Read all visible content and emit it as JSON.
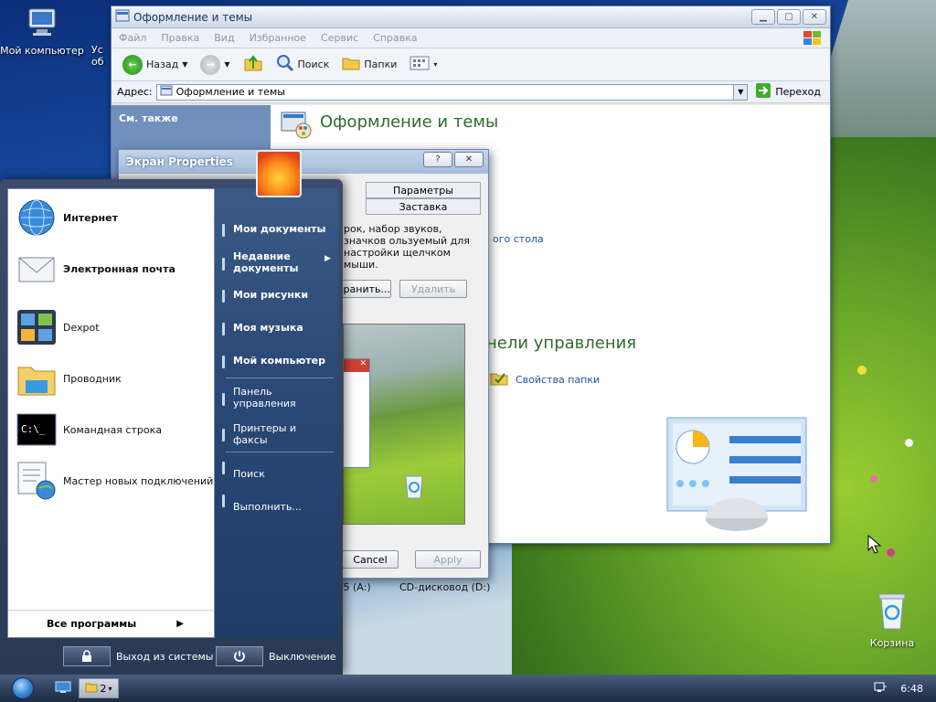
{
  "desktop": {
    "icons": [
      {
        "label": "Мой компьютер"
      },
      {
        "label": "Корзина"
      }
    ],
    "partial_label_a": "Ус",
    "partial_label_b": "об"
  },
  "window": {
    "title": "Оформление и темы",
    "menu": [
      "Файл",
      "Правка",
      "Вид",
      "Избранное",
      "Сервис",
      "Справка"
    ],
    "toolbar": {
      "back": "Назад",
      "search": "Поиск",
      "folders": "Папки"
    },
    "address": {
      "label": "Адрес:",
      "value": "Оформление и темы",
      "go": "Переход"
    },
    "left_pane": {
      "section": "См. также"
    },
    "content": {
      "title": "Оформление и темы",
      "link_desktop": "ого стола",
      "cp_header": "нели управления",
      "folder_options": "Свойства папки",
      "drive_floppy": ",5 (A:)",
      "drive_cd": "CD-дисковод (D:)"
    }
  },
  "dialog": {
    "title": "Экран Properties",
    "tabs": [
      "Параметры",
      "Заставка"
    ],
    "text": "рок, набор звуков, значков ользуемый для настройки щелчком мыши.",
    "save_button": "хранить...",
    "delete_button": "Удалить",
    "cancel_button": "Cancel",
    "apply_button": "Apply"
  },
  "start_menu": {
    "pinned": [
      {
        "label": "Интернет",
        "bold": true
      },
      {
        "label": "Электронная почта",
        "bold": true
      },
      {
        "label": "Dexpot",
        "bold": false
      },
      {
        "label": "Проводник",
        "bold": false
      },
      {
        "label": "Командная строка",
        "bold": false
      },
      {
        "label": "Мастер новых подключений",
        "bold": false
      }
    ],
    "all_programs": "Все программы",
    "right": {
      "my_documents": "Мои документы",
      "recent_docs": "Недавние документы",
      "my_pictures": "Мои рисунки",
      "my_music": "Моя музыка",
      "my_computer": "Мой компьютер",
      "control_panel": "Панель управления",
      "printers": "Принтеры и факсы",
      "search": "Поиск",
      "run": "Выполнить..."
    },
    "logoff": "Выход из системы",
    "shutdown": "Выключение"
  },
  "taskbar": {
    "group_count": "2",
    "clock": "6:48"
  }
}
